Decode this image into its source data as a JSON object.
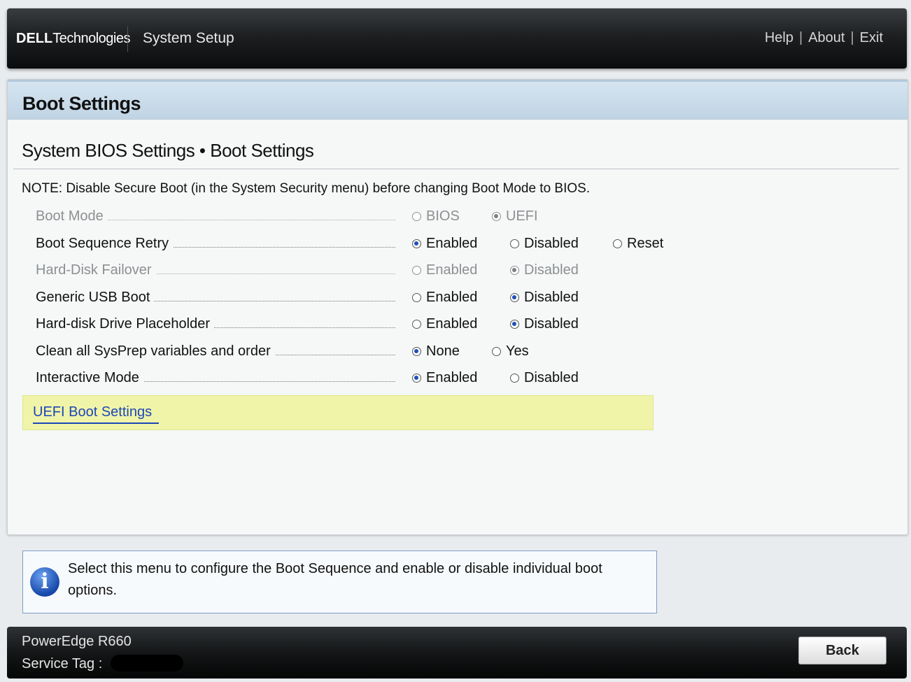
{
  "header": {
    "logo_dell": "DELL",
    "logo_tech": "Technologies",
    "title": "System Setup",
    "links": [
      "Help",
      "About",
      "Exit"
    ],
    "separator": "|"
  },
  "page": {
    "title": "Boot Settings",
    "breadcrumb": "System BIOS Settings • Boot Settings",
    "note": "NOTE: Disable Secure Boot (in the System Security menu) before changing Boot Mode to BIOS."
  },
  "settings": [
    {
      "label": "Boot Mode",
      "disabled": true,
      "options": [
        "BIOS",
        "UEFI"
      ],
      "selected": 1
    },
    {
      "label": "Boot Sequence Retry",
      "disabled": false,
      "options": [
        "Enabled",
        "Disabled",
        "Reset"
      ],
      "selected": 0
    },
    {
      "label": "Hard-Disk Failover",
      "disabled": true,
      "options": [
        "Enabled",
        "Disabled"
      ],
      "selected": 1
    },
    {
      "label": "Generic USB Boot",
      "disabled": false,
      "options": [
        "Enabled",
        "Disabled"
      ],
      "selected": 1
    },
    {
      "label": "Hard-disk Drive Placeholder",
      "disabled": false,
      "options": [
        "Enabled",
        "Disabled"
      ],
      "selected": 1
    },
    {
      "label": "Clean all SysPrep variables and order",
      "disabled": false,
      "options": [
        "None",
        "Yes"
      ],
      "selected": 0
    },
    {
      "label": "Interactive Mode",
      "disabled": false,
      "options": [
        "Enabled",
        "Disabled"
      ],
      "selected": 0
    }
  ],
  "submenu": {
    "label": "UEFI Boot Settings"
  },
  "info": {
    "icon": "info-icon",
    "text": "Select this menu to configure the Boot Sequence and enable or disable individual boot options."
  },
  "footer": {
    "model": "PowerEdge R660",
    "service_tag_label": "Service Tag :",
    "back_label": "Back"
  },
  "colors": {
    "accent": "#1f4fb8",
    "highlight": "#f0f4a8",
    "titlebar": "#c9dbea"
  }
}
